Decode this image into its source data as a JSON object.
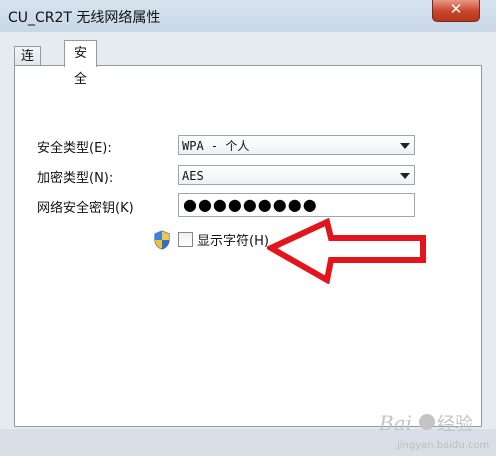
{
  "window": {
    "title": "CU_CR2T 无线网络属性",
    "close_glyph": "✕"
  },
  "tabs": [
    {
      "label": "连接",
      "active": false
    },
    {
      "label": "安全",
      "active": true
    }
  ],
  "security": {
    "security_type_label": "安全类型(E):",
    "security_type_value": "WPA - 个人",
    "encryption_type_label": "加密类型(N):",
    "encryption_type_value": "AES",
    "key_label": "网络安全密钥(K)",
    "key_value": "●●●●●●●●●",
    "show_chars_label": "显示字符(H)",
    "show_chars_checked": false
  },
  "annotation": {
    "arrow_color": "#e4141c"
  },
  "watermark": {
    "logo_text": "Baidu 经验",
    "url": "jingyan.baidu.com"
  },
  "colors": {
    "panel_bg": "#ffffff",
    "frame_bg": "#e6ebf0",
    "close_red": "#c9472b"
  }
}
